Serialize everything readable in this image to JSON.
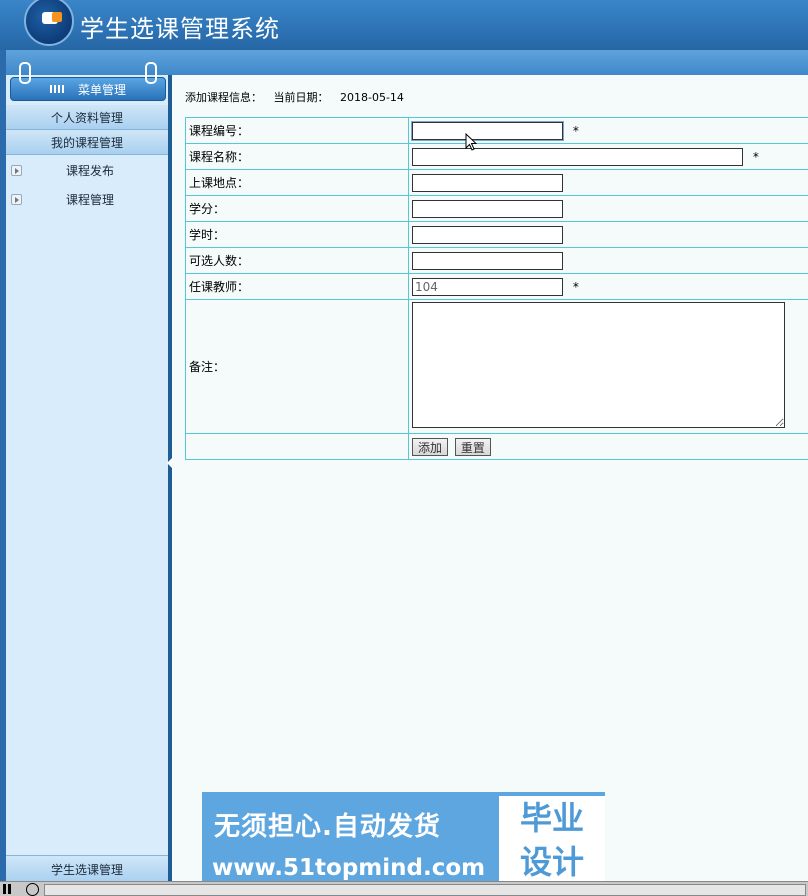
{
  "app": {
    "title": "学生选课管理系统"
  },
  "sidebar": {
    "menu_title": "菜单管理",
    "sections": [
      "个人资料管理",
      "我的课程管理"
    ],
    "items": [
      {
        "label": "课程发布"
      },
      {
        "label": "课程管理"
      }
    ],
    "footer": "学生选课管理"
  },
  "main": {
    "info_label": "添加课程信息：",
    "date_label": "当前日期：",
    "date_value": "2018-05-14",
    "form": {
      "course_no_label": "课程编号：",
      "course_name_label": "课程名称：",
      "location_label": "上课地点：",
      "credit_label": "学分：",
      "hours_label": "学时：",
      "capacity_label": "可选人数：",
      "teacher_label": "任课教师：",
      "teacher_value": "104",
      "remark_label": "备注：",
      "required_mark": "*",
      "add_button": "添加",
      "reset_button": "重置"
    }
  },
  "watermark": {
    "line1": "无须担心.自动发货",
    "line2": "www.51topmind.com",
    "box_top": "毕业",
    "box_bottom": "设计"
  }
}
